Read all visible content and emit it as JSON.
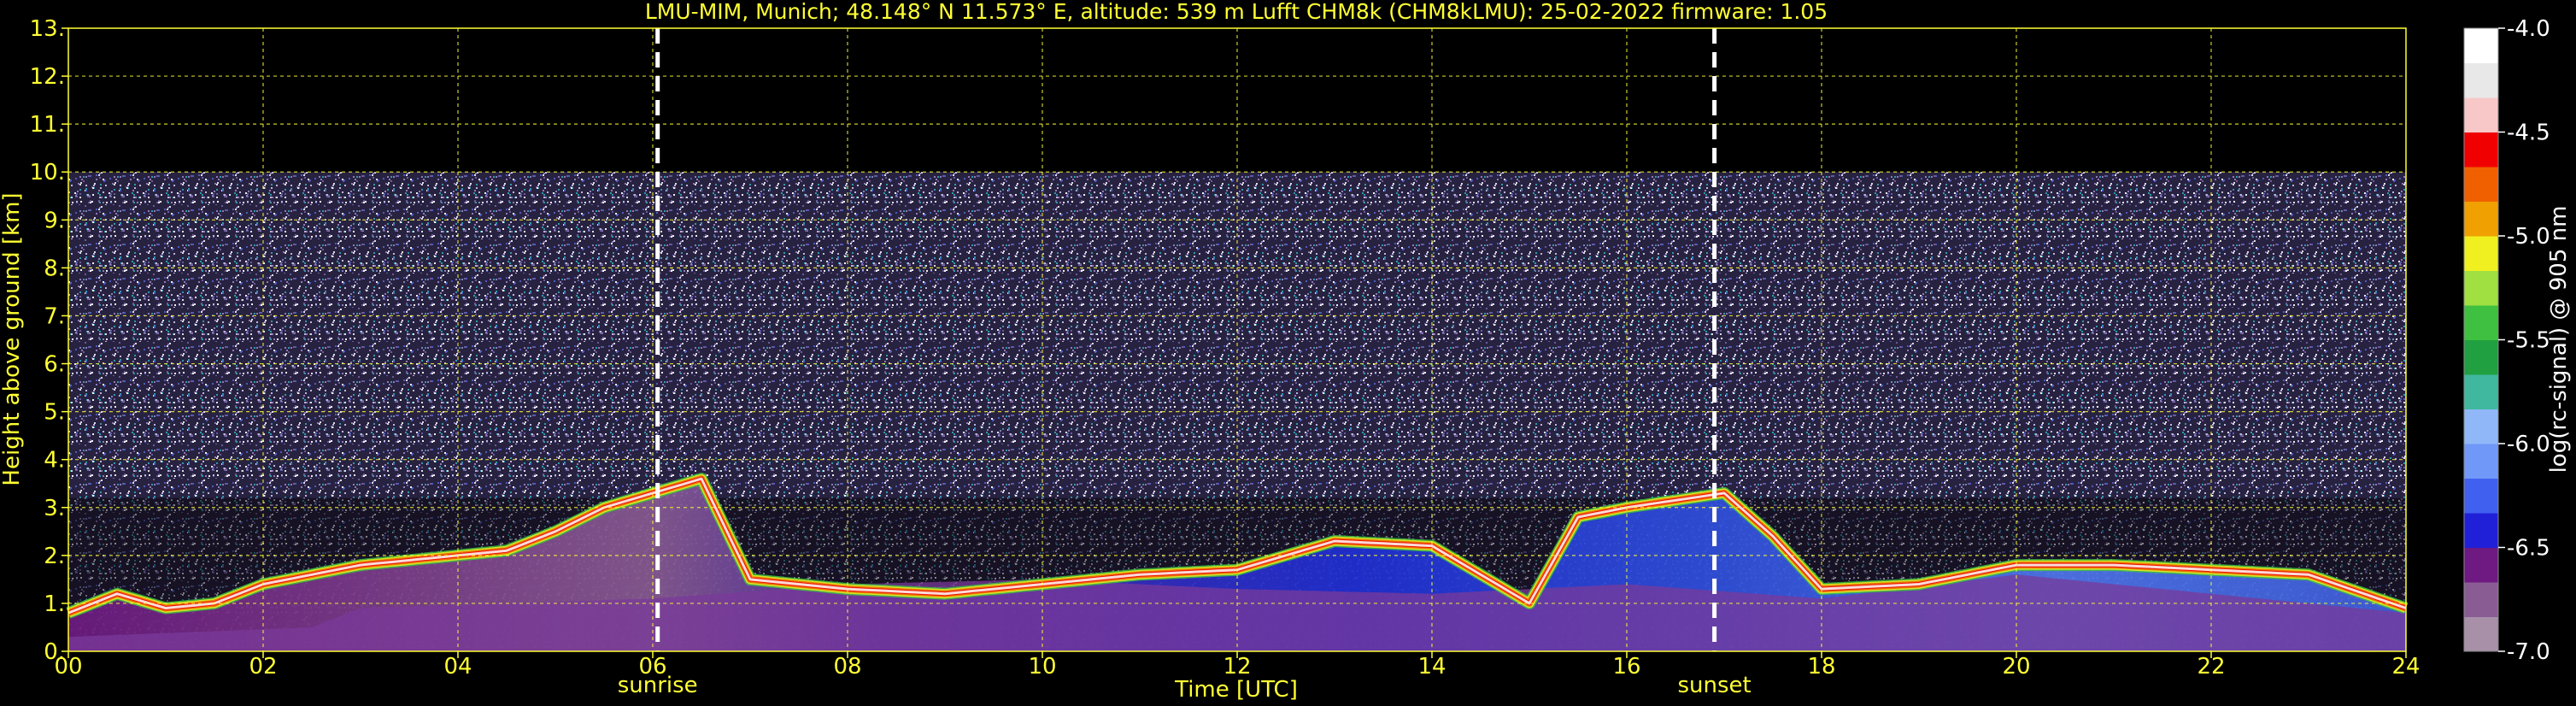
{
  "chart_data": {
    "type": "heatmap",
    "title": "LMU-MIM, Munich; 48.148° N 11.573° E, altitude: 539 m    Lufft CHM8k (CHM8kLMU): 25-02-2022    firmware: 1.05",
    "xlabel": "Time [UTC]",
    "ylabel": "Height above ground [km]",
    "xlim": [
      0,
      24
    ],
    "ylim": [
      0,
      13
    ],
    "x_ticks": [
      "00",
      "02",
      "04",
      "06",
      "08",
      "10",
      "12",
      "14",
      "16",
      "18",
      "20",
      "22",
      "24"
    ],
    "y_ticks": [
      "0.",
      "1.",
      "2.",
      "3.",
      "4.",
      "5.",
      "6.",
      "7.",
      "8.",
      "9.",
      "10.",
      "11.",
      "12.",
      "13."
    ],
    "grid": true,
    "data_top_km": 10,
    "colorbar": {
      "label": "log(rc-signal) @ 905 nm",
      "range": [
        -7.0,
        -4.0
      ],
      "ticks": [
        "-4.0",
        "-4.5",
        "-5.0",
        "-5.5",
        "-6.0",
        "-6.5",
        "-7.0"
      ],
      "colors": [
        "#a890a8",
        "#8a5c94",
        "#6e1a82",
        "#2020d8",
        "#4060f0",
        "#7098f8",
        "#90b8f8",
        "#40b8a0",
        "#20a040",
        "#40c040",
        "#a0e040",
        "#f0f020",
        "#f0a000",
        "#f06000",
        "#f00000",
        "#f8c8c8",
        "#e8e8e8",
        "#ffffff"
      ]
    },
    "annotations": [
      {
        "text": "sunrise",
        "x": 6.05
      },
      {
        "text": "sunset",
        "x": 16.9
      }
    ],
    "features": {
      "boundary_layer_top_km": [
        [
          0,
          0.8
        ],
        [
          0.5,
          1.2
        ],
        [
          1.0,
          0.9
        ],
        [
          1.5,
          1.0
        ],
        [
          2.0,
          1.4
        ],
        [
          2.5,
          1.6
        ],
        [
          3.0,
          1.8
        ],
        [
          3.5,
          1.9
        ],
        [
          4.0,
          2.0
        ],
        [
          4.5,
          2.1
        ],
        [
          5.0,
          2.5
        ],
        [
          5.5,
          3.0
        ],
        [
          6.0,
          3.3
        ],
        [
          6.5,
          3.6
        ],
        [
          7.0,
          1.5
        ],
        [
          8.0,
          1.3
        ],
        [
          9.0,
          1.2
        ],
        [
          10.0,
          1.4
        ],
        [
          11.0,
          1.6
        ],
        [
          12.0,
          1.7
        ],
        [
          13.0,
          2.3
        ],
        [
          14.0,
          2.2
        ],
        [
          15.0,
          1.0
        ],
        [
          15.5,
          2.8
        ],
        [
          16.0,
          3.0
        ],
        [
          17.0,
          3.3
        ],
        [
          17.5,
          2.4
        ],
        [
          18.0,
          1.3
        ],
        [
          19.0,
          1.4
        ],
        [
          20.0,
          1.8
        ],
        [
          21.0,
          1.8
        ],
        [
          22.0,
          1.7
        ],
        [
          23.0,
          1.6
        ],
        [
          24.0,
          0.9
        ]
      ],
      "aerosol_layer_top_km": [
        [
          0,
          0.3
        ],
        [
          2.5,
          0.5
        ],
        [
          3.0,
          0.9
        ],
        [
          6.0,
          1.1
        ],
        [
          8.0,
          1.4
        ],
        [
          10.0,
          1.5
        ],
        [
          12.0,
          1.3
        ],
        [
          14.0,
          1.2
        ],
        [
          16.0,
          1.4
        ],
        [
          18.0,
          1.1
        ],
        [
          20.0,
          1.6
        ],
        [
          22.0,
          1.2
        ],
        [
          24.0,
          0.8
        ]
      ],
      "aerosol_layer_bottom_km": [
        [
          0,
          0.0
        ],
        [
          24,
          0.0
        ]
      ]
    }
  }
}
